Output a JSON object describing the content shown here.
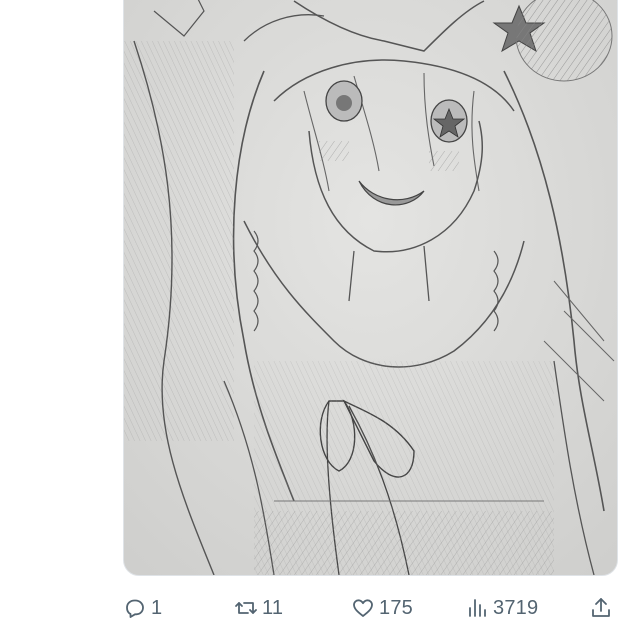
{
  "post": {
    "media": {
      "description_icon": "sketch-image"
    },
    "actions": {
      "reply_count": "1",
      "repost_count": "11",
      "like_count": "175",
      "view_count": "3719"
    },
    "colors": {
      "action_gray": "#536471",
      "paper": "#dcdcdc",
      "pencil": "#555555"
    }
  }
}
